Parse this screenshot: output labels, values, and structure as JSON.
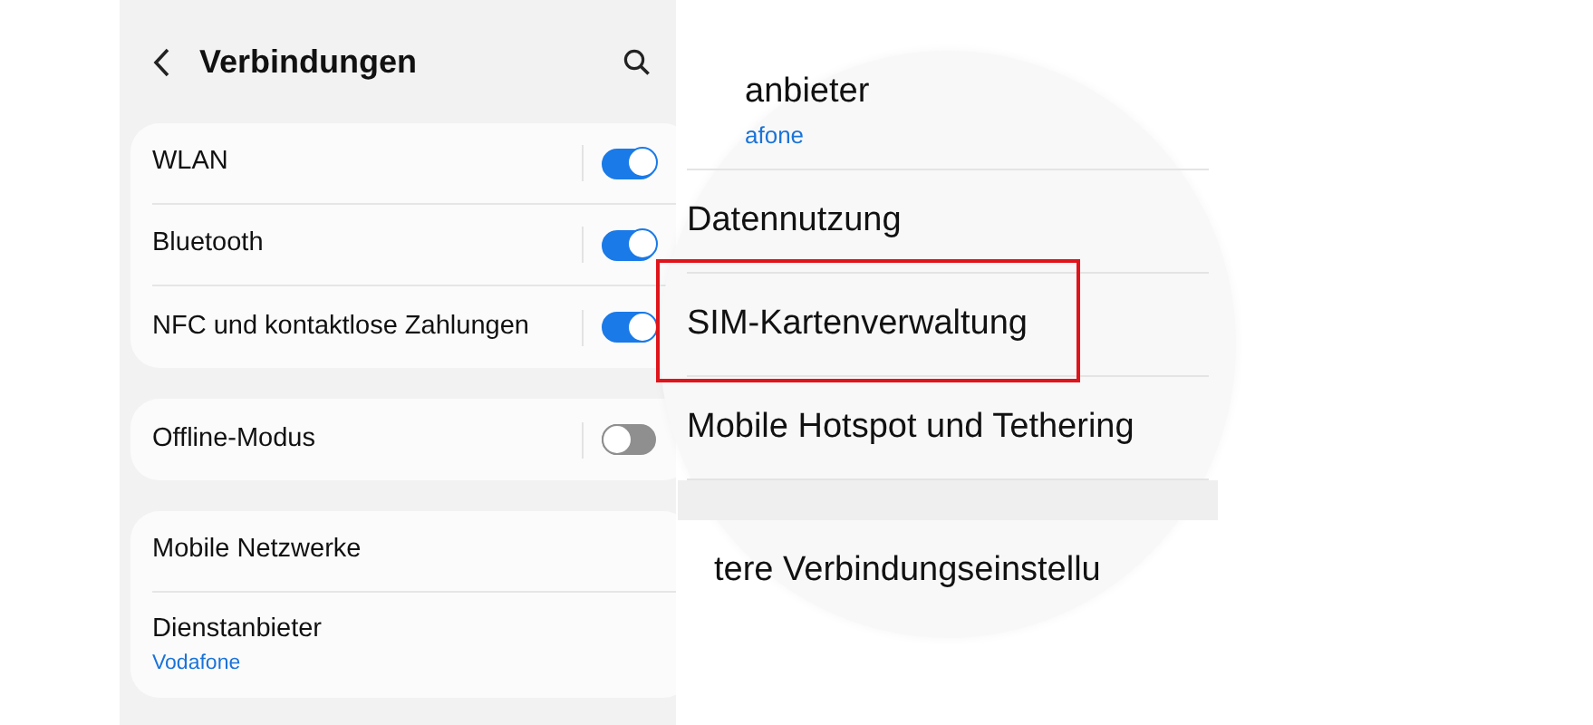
{
  "header": {
    "title": "Verbindungen"
  },
  "groups": [
    {
      "items": [
        {
          "kind": "toggle",
          "label": "WLAN",
          "on": true
        },
        {
          "kind": "toggle",
          "label": "Bluetooth",
          "on": true
        },
        {
          "kind": "toggle",
          "label": "NFC und kontaktlose Zahlungen",
          "on": true
        }
      ]
    },
    {
      "items": [
        {
          "kind": "toggle",
          "label": "Offline-Modus",
          "on": false
        }
      ]
    },
    {
      "items": [
        {
          "kind": "link",
          "label": "Mobile Netzwerke"
        },
        {
          "kind": "link",
          "label": "Dienstanbieter",
          "sublabel": "Vodafone"
        }
      ]
    }
  ],
  "magnifier": {
    "rows": [
      {
        "label": "anbieter",
        "sublabel": "afone",
        "new_section": false
      },
      {
        "label": "Datennutzung",
        "new_section": false
      },
      {
        "label": "SIM-Kartenverwaltung",
        "highlighted": true,
        "new_section": false
      },
      {
        "label": "Mobile Hotspot und Tethering",
        "new_section": false
      },
      {
        "label": "tere Verbindungseinstellu",
        "new_section": true
      }
    ]
  }
}
